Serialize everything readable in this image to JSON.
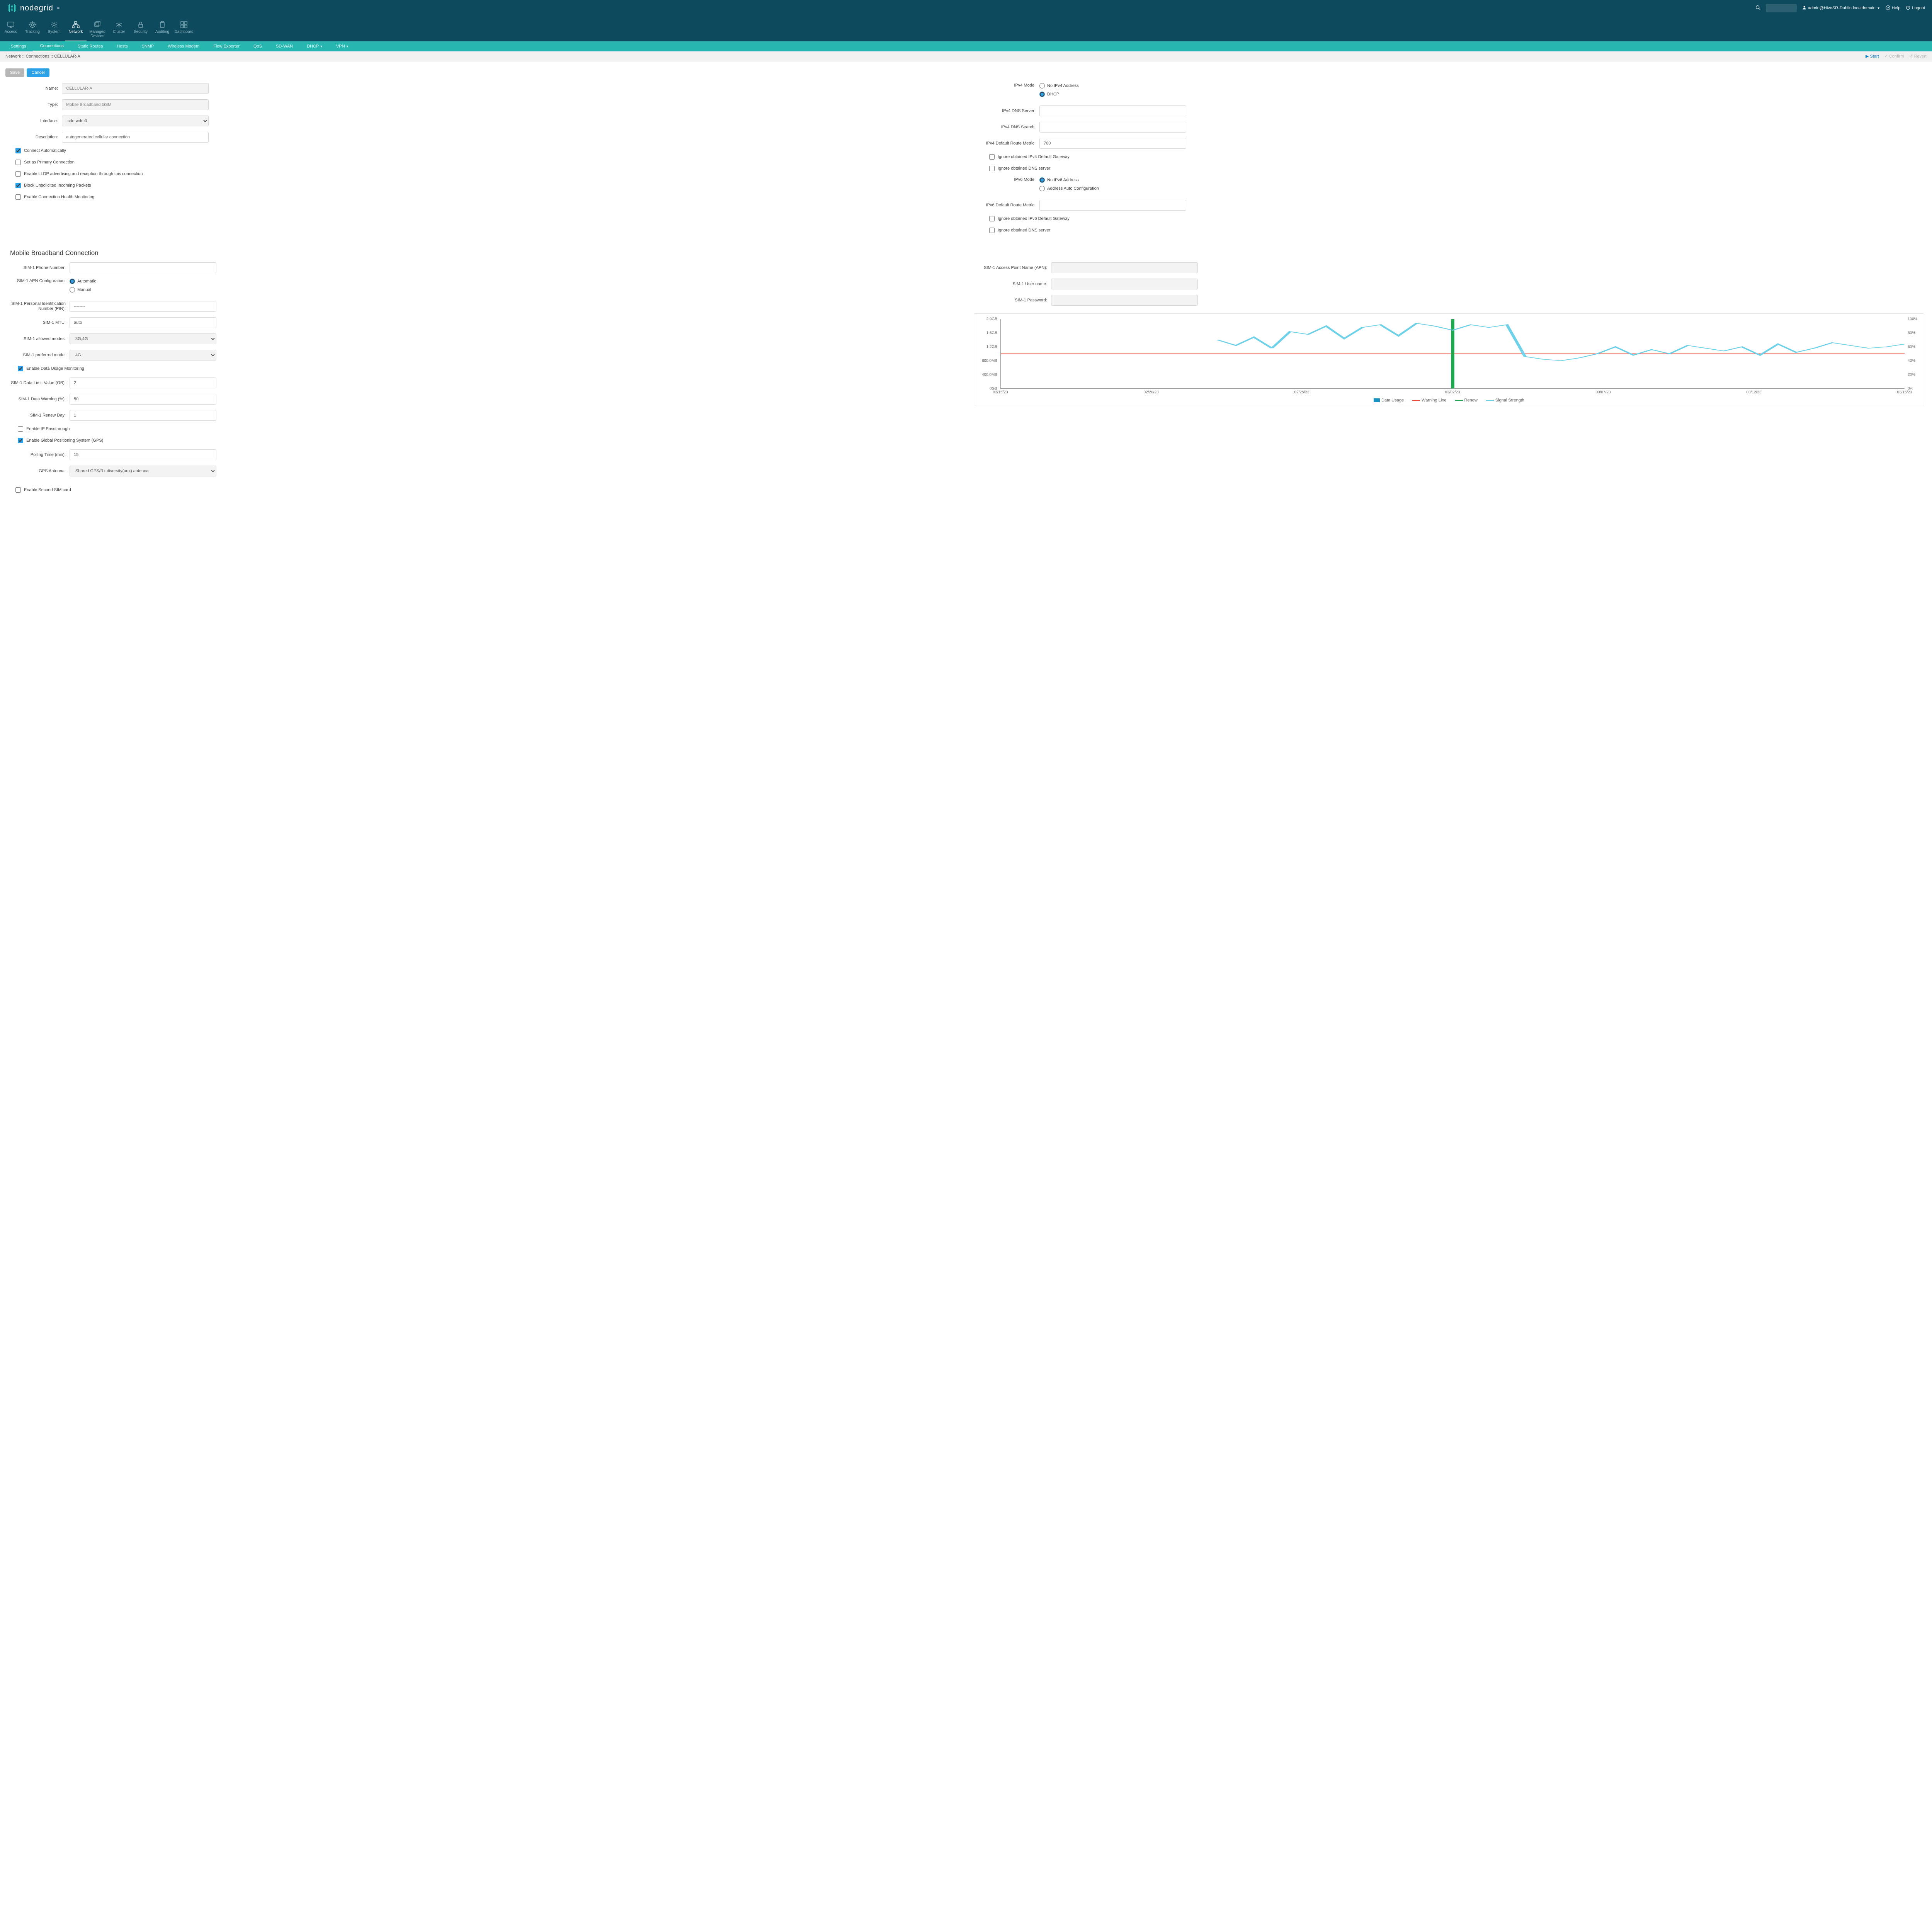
{
  "brand": "nodegrid",
  "header": {
    "user_label": "admin@HiveSR-Dublin.localdomain",
    "help": "Help",
    "logout": "Logout"
  },
  "modules": [
    {
      "label": "Access",
      "icon": "monitor"
    },
    {
      "label": "Tracking",
      "icon": "target"
    },
    {
      "label": "System",
      "icon": "gear"
    },
    {
      "label": "Network",
      "icon": "network",
      "active": true
    },
    {
      "label": "Managed Devices",
      "icon": "window-stack"
    },
    {
      "label": "Cluster",
      "icon": "snowflake"
    },
    {
      "label": "Security",
      "icon": "lock"
    },
    {
      "label": "Auditing",
      "icon": "clipboard"
    },
    {
      "label": "Dashboard",
      "icon": "dashboard"
    }
  ],
  "subnav": [
    {
      "label": "Settings"
    },
    {
      "label": "Connections",
      "active": true
    },
    {
      "label": "Static Routes"
    },
    {
      "label": "Hosts"
    },
    {
      "label": "SNMP"
    },
    {
      "label": "Wireless Modem"
    },
    {
      "label": "Flow Exporter"
    },
    {
      "label": "QoS"
    },
    {
      "label": "SD-WAN"
    },
    {
      "label": "DHCP",
      "dropdown": true
    },
    {
      "label": "VPN",
      "dropdown": true
    }
  ],
  "breadcrumb": "Network :: Connections :: CELLULAR-A",
  "crumb_actions": {
    "start": "Start",
    "confirm": "Confirm",
    "revert": "Revert"
  },
  "buttons": {
    "save": "Save",
    "cancel": "Cancel"
  },
  "left": {
    "name_label": "Name:",
    "name_value": "CELLULAR-A",
    "type_label": "Type:",
    "type_value": "Mobile Broadband GSM",
    "iface_label": "Interface:",
    "iface_value": "cdc-wdm0",
    "desc_label": "Description:",
    "desc_value": "autogenerated cellular connection",
    "chk_connect_auto": "Connect Automatically",
    "chk_primary": "Set as Primary Connection",
    "chk_lldp": "Enable LLDP advertising and reception through this connection",
    "chk_block": "Block Unsolicited Incoming Packets",
    "chk_health": "Enable Connection Health Monitoring"
  },
  "right": {
    "ipv4_mode_label": "IPv4 Mode:",
    "ipv4_opt_none": "No IPv4 Address",
    "ipv4_opt_dhcp": "DHCP",
    "ipv4_dns_label": "IPv4 DNS Server:",
    "ipv4_dns_search_label": "IPv4 DNS Search:",
    "ipv4_metric_label": "IPv4 Default Route Metric:",
    "ipv4_metric_value": "700",
    "chk_ign_gw4": "Ignore obtained IPv4 Default Gateway",
    "chk_ign_dns4": "Ignore obtained DNS server",
    "ipv6_mode_label": "IPv6 Mode:",
    "ipv6_opt_none": "No IPv6 Address",
    "ipv6_opt_auto": "Address Auto Configuration",
    "ipv6_metric_label": "IPv6 Default Route Metric:",
    "chk_ign_gw6": "Ignore obtained IPv6 Default Gateway",
    "chk_ign_dns6": "Ignore obtained DNS server"
  },
  "section_title": "Mobile Broadband Connection",
  "mb_left": {
    "phone_label": "SIM-1 Phone Number:",
    "apn_cfg_label": "SIM-1 APN Configuration:",
    "apn_auto": "Automatic",
    "apn_manual": "Manual",
    "pin_label": "SIM-1 Personal Identification Number (PIN):",
    "pin_value": "--------",
    "mtu_label": "SIM-1 MTU:",
    "mtu_value": "auto",
    "allowed_label": "SIM-1 allowed modes:",
    "allowed_value": "3G,4G",
    "pref_label": "SIM-1 preferred mode:",
    "pref_value": "4G",
    "chk_data_mon": "Enable Data Usage Monitoring",
    "limit_label": "SIM-1 Data Limit Value (GB):",
    "limit_value": "2",
    "warn_label": "SIM-1 Data Warning (%):",
    "warn_value": "50",
    "renew_label": "SIM-1 Renew Day:",
    "renew_value": "1",
    "chk_passthrough": "Enable IP Passthrough",
    "chk_gps": "Enable Global Positioning System (GPS)",
    "poll_label": "Polling Time (min):",
    "poll_value": "15",
    "ant_label": "GPS Antenna:",
    "ant_value": "Shared GPS/Rx diversity(aux) antenna",
    "chk_sim2": "Enable Second SIM card"
  },
  "mb_right": {
    "apn_label": "SIM-1 Access Point Name (APN):",
    "user_label": "SIM-1 User name:",
    "pass_label": "SIM-1 Password:"
  },
  "chart_data": {
    "type": "line",
    "y_ticks": [
      "0GB",
      "400.0MB",
      "800.0MB",
      "1.2GB",
      "1.6GB",
      "2.0GB"
    ],
    "y2_ticks": [
      "0%",
      "20%",
      "40%",
      "60%",
      "80%",
      "100%"
    ],
    "x_ticks": [
      "02/15/23",
      "02/20/23",
      "02/25/23",
      "03/02/23",
      "03/07/23",
      "03/12/23",
      "03/15/23"
    ],
    "warning_pct": 50,
    "renew_x_index": 3,
    "series": [
      {
        "name": "Data Usage",
        "color": "#1893c1",
        "type": "fill"
      },
      {
        "name": "Warning Line",
        "color": "#e74c3c",
        "type": "line"
      },
      {
        "name": "Renew",
        "color": "#1fa84e",
        "type": "vline"
      },
      {
        "name": "Signal Strength",
        "color": "#6fd1e8",
        "type": "line",
        "values_pct": [
          null,
          null,
          null,
          null,
          null,
          null,
          null,
          null,
          null,
          null,
          null,
          null,
          70,
          62,
          74,
          58,
          82,
          78,
          90,
          72,
          88,
          92,
          76,
          94,
          90,
          84,
          92,
          88,
          92,
          46,
          42,
          40,
          44,
          50,
          60,
          48,
          56,
          50,
          62,
          58,
          54,
          60,
          48,
          64,
          52,
          58,
          66,
          62,
          58,
          60,
          64
        ]
      }
    ],
    "legend": [
      "Data Usage",
      "Warning Line",
      "Renew",
      "Signal Strength"
    ]
  }
}
